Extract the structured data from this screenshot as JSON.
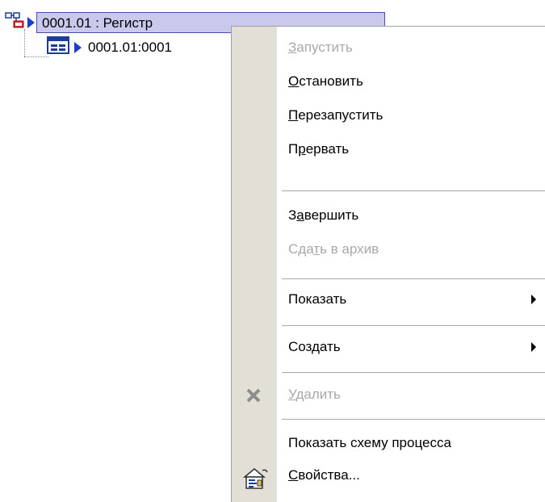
{
  "tree": {
    "root_label": "0001.01 : Регистр",
    "child_label": "0001.01:0001"
  },
  "menu": {
    "items": [
      {
        "pre": "",
        "u": "З",
        "post": "апустить",
        "disabled": true
      },
      {
        "pre": "",
        "u": "О",
        "post": "становить",
        "disabled": false
      },
      {
        "pre": "",
        "u": "П",
        "post": "ерезапустить",
        "disabled": false
      },
      {
        "pre": "П",
        "u": "р",
        "post": "ервать",
        "disabled": false
      },
      {
        "pre": "З",
        "u": "а",
        "post": "вершить",
        "disabled": false
      },
      {
        "pre": "Сда",
        "u": "т",
        "post": "ь в архив",
        "disabled": true
      },
      {
        "pre": "Показать",
        "u": "",
        "post": "",
        "disabled": false,
        "submenu": true
      },
      {
        "pre": "Создать",
        "u": "",
        "post": "",
        "disabled": false,
        "submenu": true
      },
      {
        "pre": "",
        "u": "У",
        "post": "далить",
        "disabled": true,
        "icon": "delete-x-icon"
      },
      {
        "pre": "Показать схему процесса",
        "u": "",
        "post": "",
        "disabled": false
      },
      {
        "pre": "",
        "u": "С",
        "post": "войства...",
        "disabled": false,
        "icon": "properties-icon"
      }
    ]
  }
}
